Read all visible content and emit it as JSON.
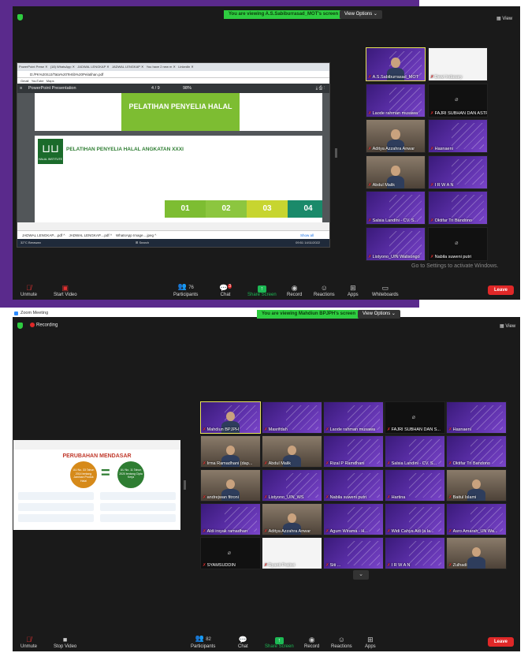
{
  "colors": {
    "accent_green": "#2ecc40",
    "leave_red": "#e02828",
    "purple_bg": "#5a2a8c",
    "slide_green": "#7dbd32"
  },
  "shot1": {
    "banner": "You are viewing A.S.Sabiburrasad_MOT's screen",
    "view_options": "View Options",
    "view_label": "View",
    "browser": {
      "tabs": [
        "PowerPoint Prese",
        "(18) WhatsApp",
        "JADWAL LENGKAP",
        "JADWAL LENGKAP",
        "You have 2 new m",
        "LinkedIn"
      ],
      "url": "D:/PK%20SJJ/Tata%20Tertib%20Pelatihan.pdf",
      "bookmarks": [
        "Gmail",
        "YouTube",
        "Maps"
      ],
      "pdf_title": "PowerPoint Presentation",
      "page_indicator": "4 / 9",
      "zoom": "98%",
      "slide1_title": "PELATIHAN PENYELIA HALAL",
      "slide2_title": "PELATIHAN PENYELIA HALAL ANGKATAN XXXI",
      "logo_text": "HALAL INSTITUTE",
      "numbers": [
        "01",
        "02",
        "03",
        "04"
      ],
      "downloads": [
        "JADWAL LENGKAP....pdf",
        "JADWAL LENGKAP....pdf",
        "WhatsApp Image....jpeg"
      ],
      "show_all": "Show all",
      "weather": "32°C Berawan",
      "search": "Search",
      "time": "09:51",
      "date": "14/11/2022"
    },
    "participants": [
      {
        "name": "A.S.Sabiburrasad_MOT",
        "type": "active"
      },
      {
        "name": "Dewi Indasary",
        "type": "white"
      },
      {
        "name": "Laode rahman musawa",
        "type": "slide"
      },
      {
        "name": "FAJRI SUBHAN DAN ASTRID FT...",
        "type": "dark"
      },
      {
        "name": "Aditya Azzahra Anwar",
        "type": "cam"
      },
      {
        "name": "Hasnaeni",
        "type": "slide"
      },
      {
        "name": "Abdul Malik",
        "type": "cam"
      },
      {
        "name": "I R W A N",
        "type": "slide"
      },
      {
        "name": "Salsia Landini - CV. S...",
        "type": "slide"
      },
      {
        "name": "Oktifar Tri Bandono",
        "type": "slide"
      },
      {
        "name": "Listyono_UIN Walisongo",
        "type": "slide"
      },
      {
        "name": "Nabila suweni putri",
        "type": "dark"
      }
    ],
    "watermark": "Go to Settings to activate Windows.",
    "toolbar": {
      "unmute": "Unmute",
      "start_video": "Start Video",
      "participants": "Participants",
      "participants_count": "76",
      "chat": "Chat",
      "chat_badge": "3",
      "share": "Share Screen",
      "record": "Record",
      "reactions": "Reactions",
      "apps": "Apps",
      "whiteboards": "Whiteboards",
      "leave": "Leave"
    }
  },
  "shot2": {
    "window_title": "Zoom Meeting",
    "banner": "You are viewing Mahdiun BPJPH's screen",
    "view_options": "View Options",
    "recording": "Recording",
    "view_label": "View",
    "slide": {
      "title": "PERUBAHAN MENDASAR",
      "left": "UU No. 33 Tahun 2014 tentang Jaminan Produk Halal",
      "right": "UU No. 11 Tahun 2020 tentang Cipta Kerja"
    },
    "participants": [
      {
        "name": "Mahdiun BPJPH",
        "type": "active"
      },
      {
        "name": "Masrifdah",
        "type": "slide"
      },
      {
        "name": "Laode rahman musawa",
        "type": "slide"
      },
      {
        "name": "FAJRI SUBHAN DAN S...",
        "type": "dark"
      },
      {
        "name": "Hasnaeni",
        "type": "slide"
      },
      {
        "name": "Irma Ramadhani (dap...",
        "type": "cam"
      },
      {
        "name": "Abdul Malik",
        "type": "cam"
      },
      {
        "name": "Rizal P Ramdhani",
        "type": "slide"
      },
      {
        "name": "Salsia Landini - CV. S...",
        "type": "slide"
      },
      {
        "name": "Oktifar Tri Bandono",
        "type": "slide"
      },
      {
        "name": "andrejwan fitroni",
        "type": "cam"
      },
      {
        "name": "Listyono_UIN_WS",
        "type": "slide"
      },
      {
        "name": "Nabila suweni putri",
        "type": "slide"
      },
      {
        "name": "Hartina",
        "type": "slide"
      },
      {
        "name": "Baitul Islami",
        "type": "cam"
      },
      {
        "name": "Aldi irsyak ramadhan",
        "type": "slide"
      },
      {
        "name": "Aditya Azzahra Anwar",
        "type": "cam"
      },
      {
        "name": "Agum Wirama - H...",
        "type": "slide"
      },
      {
        "name": "Widi Cahya Adi (a la...",
        "type": "slide"
      },
      {
        "name": "Asro Amarah_UN Wa...",
        "type": "slide"
      },
      {
        "name": "SYAMSUDDIN",
        "type": "dark"
      },
      {
        "name": "Ryanti Pratiwi",
        "type": "white"
      },
      {
        "name": "Siti ...",
        "type": "slide"
      },
      {
        "name": "I R W A N",
        "type": "slide"
      },
      {
        "name": "Zulhadi",
        "type": "cam"
      }
    ],
    "toolbar": {
      "unmute": "Unmute",
      "stop_video": "Stop Video",
      "participants": "Participants",
      "participants_count": "82",
      "chat": "Chat",
      "share": "Share Screen",
      "record": "Record",
      "reactions": "Reactions",
      "apps": "Apps",
      "leave": "Leave"
    }
  }
}
